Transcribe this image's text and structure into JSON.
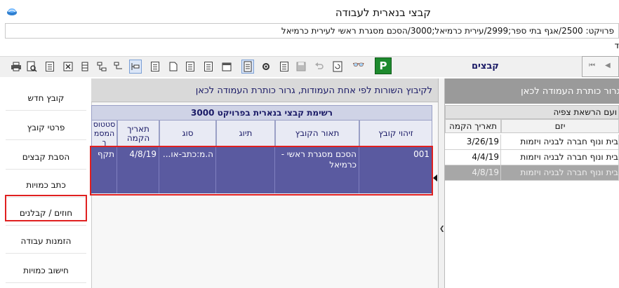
{
  "window": {
    "title": "קבצי בנארית לעבודה",
    "path": "פרויקט: 2500/אגף בתי ספר;2999/עירית כרמיאל;3000/הסכם מסגרת ראשי לעירית כרמיאל",
    "menu_letter": "ד"
  },
  "toolbar": {
    "tab_label": "קבצים",
    "p_button": "P",
    "binoculars": "👓"
  },
  "left_nav": [
    {
      "label": "קובץ חדש"
    },
    {
      "label": "פרטי קובץ"
    },
    {
      "label": "הסבת קבצים"
    },
    {
      "label": "כתב כמויות"
    },
    {
      "label": "חוזים / קבלנים"
    },
    {
      "label": "הזמנות עבודה"
    },
    {
      "label": "חישוב כמויות"
    }
  ],
  "middle": {
    "group_hint": "לקיבוץ השורות לפי אחת העמודות, גרור כותרת העמודה לכאן",
    "grid_title": "רשימת קבצי בנארית בפרויקט 3000",
    "columns": [
      "זיהוי קובץ",
      "תאור הקובץ",
      "תיוג",
      "סוג",
      "תאריך הקמה",
      "סטטוס המסמך"
    ],
    "rows": [
      {
        "id": "001",
        "desc": "הסכם מסגרת ראשי - כרמיאל",
        "tag": "",
        "type": "ה.מ:כתב-או...",
        "date": "4/8/19",
        "status": "תקף"
      }
    ]
  },
  "right": {
    "group_hint": "גרור כותרת העמודה לכאן",
    "title": "ועם הרשאת צפיה",
    "columns": [
      "יזם",
      "תאריך הקמה"
    ],
    "rows": [
      {
        "initiator": "בית ונוף חברה לבניה ויזמות",
        "date": "3/26/19"
      },
      {
        "initiator": "בית ונוף חברה לבניה ויזמות",
        "date": "4/4/19"
      },
      {
        "initiator": "בית ונוף חברה לבניה ויזמות",
        "date": "4/8/19"
      }
    ]
  }
}
